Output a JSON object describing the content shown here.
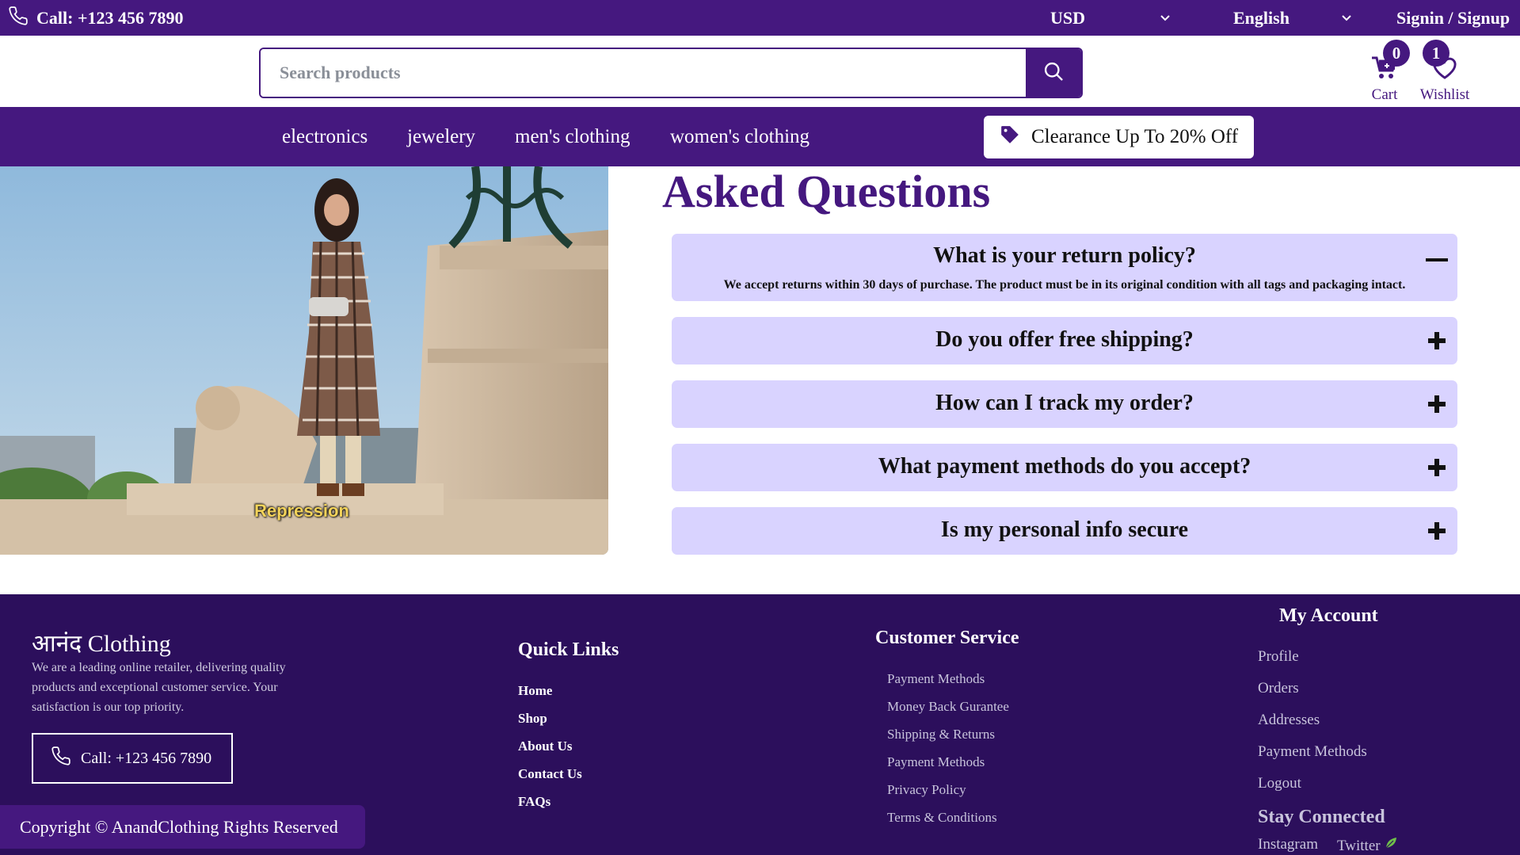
{
  "topbar": {
    "phone_label": "Call: +123 456 7890",
    "currency": "USD",
    "language": "English",
    "signin_label": "Signin / Signup"
  },
  "header": {
    "search_placeholder": "Search products",
    "cart": {
      "label": "Cart",
      "count": "0"
    },
    "wishlist": {
      "label": "Wishlist",
      "count": "1"
    }
  },
  "nav": {
    "categories": [
      "electronics",
      "jewelery",
      "men's clothing",
      "women's clothing"
    ],
    "promo_label": "Clearance Up To 20% Off"
  },
  "hero": {
    "caption": "Repression"
  },
  "faq": {
    "title": "Asked Questions",
    "items": [
      {
        "question": "What is your return policy?",
        "answer": "We accept returns within 30 days of purchase. The product must be in its original condition with all tags and packaging intact.",
        "expanded": true
      },
      {
        "question": "Do you offer free shipping?",
        "expanded": false
      },
      {
        "question": "How can I track my order?",
        "expanded": false
      },
      {
        "question": "What payment methods do you accept?",
        "expanded": false
      },
      {
        "question": "Is my personal info secure",
        "expanded": false
      }
    ]
  },
  "footer": {
    "brand_native": "आनंद",
    "brand_suffix": "Clothing",
    "about": "We are a leading online retailer, delivering quality products and exceptional customer service. Your satisfaction is our top priority.",
    "phone_label": "Call: +123 456 7890",
    "copyright": "Copyright © AnandClothing Rights Reserved",
    "quick_links": {
      "title": "Quick Links",
      "items": [
        "Home",
        "Shop",
        "About Us",
        "Contact Us",
        "FAQs"
      ]
    },
    "customer_service": {
      "title": "Customer Service",
      "items": [
        "Payment Methods",
        "Money Back Gurantee",
        "Shipping & Returns",
        "Payment Methods",
        "Privacy Policy",
        "Terms & Conditions"
      ]
    },
    "my_account": {
      "title": "My Account",
      "items": [
        "Profile",
        "Orders",
        "Addresses",
        "Payment Methods",
        "Logout"
      ]
    },
    "stay_connected": {
      "title": "Stay Connected",
      "items": [
        "Instagram",
        "Twitter"
      ]
    }
  },
  "colors": {
    "brand_purple": "#45187f",
    "footer_bg": "#2c0f5c",
    "faq_bg": "#d9d3ff"
  },
  "icons": [
    "phone-icon",
    "chevron-down-icon",
    "search-icon",
    "cart-icon",
    "heart-icon",
    "tag-icon",
    "minus-icon",
    "plus-icon",
    "leaf-icon"
  ]
}
